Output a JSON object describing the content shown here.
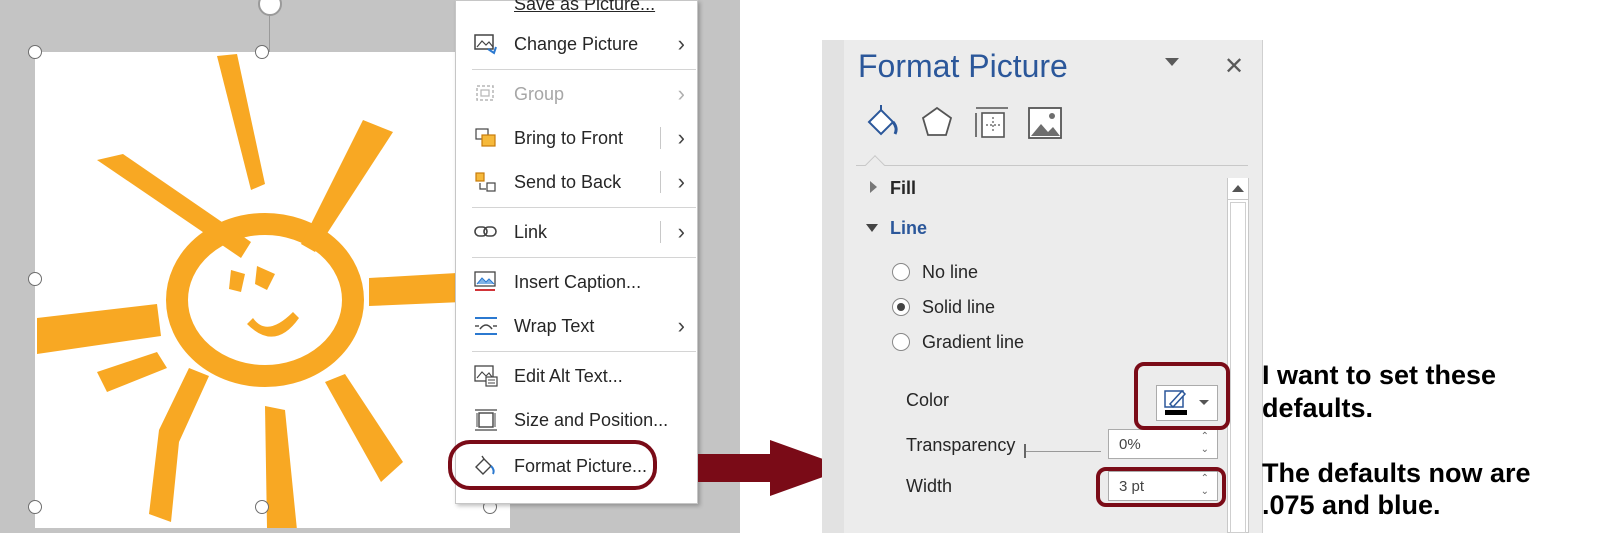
{
  "context_menu": {
    "items": [
      {
        "label": "Save as Picture...",
        "icon": "save-picture-icon",
        "submenu": false,
        "disabled": false
      },
      {
        "label": "Change Picture",
        "icon": "change-picture-icon",
        "submenu": true,
        "disabled": false
      },
      {
        "label": "Group",
        "icon": "group-icon",
        "submenu": true,
        "disabled": true
      },
      {
        "label": "Bring to Front",
        "icon": "bring-to-front-icon",
        "submenu": true,
        "disabled": false
      },
      {
        "label": "Send to Back",
        "icon": "send-to-back-icon",
        "submenu": true,
        "disabled": false
      },
      {
        "label": "Link",
        "icon": "link-icon",
        "submenu": true,
        "disabled": false
      },
      {
        "label": "Insert Caption...",
        "icon": "insert-caption-icon",
        "submenu": false,
        "disabled": false
      },
      {
        "label": "Wrap Text",
        "icon": "wrap-text-icon",
        "submenu": true,
        "disabled": false
      },
      {
        "label": "Edit Alt Text...",
        "icon": "alt-text-icon",
        "submenu": false,
        "disabled": false
      },
      {
        "label": "Size and Position...",
        "icon": "size-position-icon",
        "submenu": false,
        "disabled": false
      },
      {
        "label": "Format Picture...",
        "icon": "format-picture-icon",
        "submenu": false,
        "disabled": false
      }
    ]
  },
  "format_pane": {
    "title": "Format Picture",
    "tabs": [
      "fill-line-icon",
      "effects-icon",
      "layout-properties-icon",
      "picture-icon"
    ],
    "sections": {
      "fill": "Fill",
      "line": "Line"
    },
    "line_options": [
      "No line",
      "Solid line",
      "Gradient line"
    ],
    "selected_line_option": "Solid line",
    "color_label": "Color",
    "transparency_label": "Transparency",
    "transparency_value": "0%",
    "width_label": "Width",
    "width_value": "3 pt"
  },
  "annotation": {
    "line1": "I want to set these",
    "line2": "defaults.",
    "line3": "The defaults now are",
    "line4": ".075 and blue."
  },
  "colors": {
    "annotation": "#7a0b17",
    "sun": "#f8a823",
    "accent": "#2b579a"
  }
}
